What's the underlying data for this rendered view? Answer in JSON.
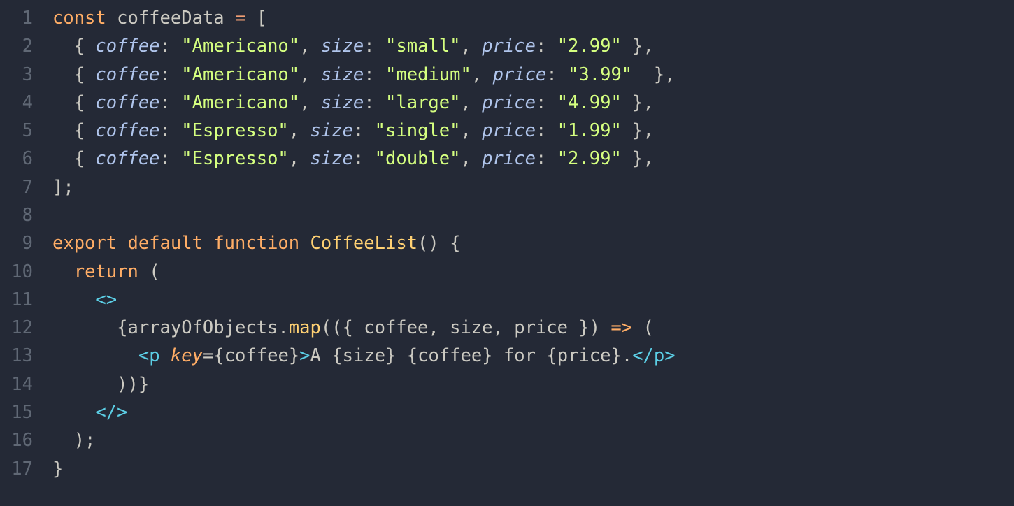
{
  "editor": {
    "lineCount": 17,
    "lines": [
      [
        {
          "t": "const",
          "c": "tok-kw"
        },
        {
          "t": " ",
          "c": ""
        },
        {
          "t": "coffeeData",
          "c": "tok-var"
        },
        {
          "t": " ",
          "c": ""
        },
        {
          "t": "=",
          "c": "tok-op"
        },
        {
          "t": " [",
          "c": "tok-punc"
        }
      ],
      [
        {
          "t": "  { ",
          "c": "tok-punc"
        },
        {
          "t": "coffee",
          "c": "tok-key"
        },
        {
          "t": ": ",
          "c": "tok-punc"
        },
        {
          "t": "\"Americano\"",
          "c": "tok-str"
        },
        {
          "t": ", ",
          "c": "tok-punc"
        },
        {
          "t": "size",
          "c": "tok-key"
        },
        {
          "t": ": ",
          "c": "tok-punc"
        },
        {
          "t": "\"small\"",
          "c": "tok-str"
        },
        {
          "t": ", ",
          "c": "tok-punc"
        },
        {
          "t": "price",
          "c": "tok-key"
        },
        {
          "t": ": ",
          "c": "tok-punc"
        },
        {
          "t": "\"2.99\"",
          "c": "tok-str"
        },
        {
          "t": " },",
          "c": "tok-punc"
        }
      ],
      [
        {
          "t": "  { ",
          "c": "tok-punc"
        },
        {
          "t": "coffee",
          "c": "tok-key"
        },
        {
          "t": ": ",
          "c": "tok-punc"
        },
        {
          "t": "\"Americano\"",
          "c": "tok-str"
        },
        {
          "t": ", ",
          "c": "tok-punc"
        },
        {
          "t": "size",
          "c": "tok-key"
        },
        {
          "t": ": ",
          "c": "tok-punc"
        },
        {
          "t": "\"medium\"",
          "c": "tok-str"
        },
        {
          "t": ", ",
          "c": "tok-punc"
        },
        {
          "t": "price",
          "c": "tok-key"
        },
        {
          "t": ": ",
          "c": "tok-punc"
        },
        {
          "t": "\"3.99\"",
          "c": "tok-str"
        },
        {
          "t": "  },",
          "c": "tok-punc"
        }
      ],
      [
        {
          "t": "  { ",
          "c": "tok-punc"
        },
        {
          "t": "coffee",
          "c": "tok-key"
        },
        {
          "t": ": ",
          "c": "tok-punc"
        },
        {
          "t": "\"Americano\"",
          "c": "tok-str"
        },
        {
          "t": ", ",
          "c": "tok-punc"
        },
        {
          "t": "size",
          "c": "tok-key"
        },
        {
          "t": ": ",
          "c": "tok-punc"
        },
        {
          "t": "\"large\"",
          "c": "tok-str"
        },
        {
          "t": ", ",
          "c": "tok-punc"
        },
        {
          "t": "price",
          "c": "tok-key"
        },
        {
          "t": ": ",
          "c": "tok-punc"
        },
        {
          "t": "\"4.99\"",
          "c": "tok-str"
        },
        {
          "t": " },",
          "c": "tok-punc"
        }
      ],
      [
        {
          "t": "  { ",
          "c": "tok-punc"
        },
        {
          "t": "coffee",
          "c": "tok-key"
        },
        {
          "t": ": ",
          "c": "tok-punc"
        },
        {
          "t": "\"Espresso\"",
          "c": "tok-str"
        },
        {
          "t": ", ",
          "c": "tok-punc"
        },
        {
          "t": "size",
          "c": "tok-key"
        },
        {
          "t": ": ",
          "c": "tok-punc"
        },
        {
          "t": "\"single\"",
          "c": "tok-str"
        },
        {
          "t": ", ",
          "c": "tok-punc"
        },
        {
          "t": "price",
          "c": "tok-key"
        },
        {
          "t": ": ",
          "c": "tok-punc"
        },
        {
          "t": "\"1.99\"",
          "c": "tok-str"
        },
        {
          "t": " },",
          "c": "tok-punc"
        }
      ],
      [
        {
          "t": "  { ",
          "c": "tok-punc"
        },
        {
          "t": "coffee",
          "c": "tok-key"
        },
        {
          "t": ": ",
          "c": "tok-punc"
        },
        {
          "t": "\"Espresso\"",
          "c": "tok-str"
        },
        {
          "t": ", ",
          "c": "tok-punc"
        },
        {
          "t": "size",
          "c": "tok-key"
        },
        {
          "t": ": ",
          "c": "tok-punc"
        },
        {
          "t": "\"double\"",
          "c": "tok-str"
        },
        {
          "t": ", ",
          "c": "tok-punc"
        },
        {
          "t": "price",
          "c": "tok-key"
        },
        {
          "t": ": ",
          "c": "tok-punc"
        },
        {
          "t": "\"2.99\"",
          "c": "tok-str"
        },
        {
          "t": " },",
          "c": "tok-punc"
        }
      ],
      [
        {
          "t": "];",
          "c": "tok-punc"
        }
      ],
      [
        {
          "t": " ",
          "c": ""
        }
      ],
      [
        {
          "t": "export",
          "c": "tok-kw"
        },
        {
          "t": " ",
          "c": ""
        },
        {
          "t": "default",
          "c": "tok-kw"
        },
        {
          "t": " ",
          "c": ""
        },
        {
          "t": "function",
          "c": "tok-kw"
        },
        {
          "t": " ",
          "c": ""
        },
        {
          "t": "CoffeeList",
          "c": "tok-fn"
        },
        {
          "t": "() {",
          "c": "tok-punc"
        }
      ],
      [
        {
          "t": "  ",
          "c": ""
        },
        {
          "t": "return",
          "c": "tok-kw"
        },
        {
          "t": " (",
          "c": "tok-punc"
        }
      ],
      [
        {
          "t": "    ",
          "c": ""
        },
        {
          "t": "<>",
          "c": "tok-tag"
        }
      ],
      [
        {
          "t": "      {",
          "c": "tok-punc"
        },
        {
          "t": "arrayOfObjects",
          "c": "tok-var"
        },
        {
          "t": ".",
          "c": "tok-punc"
        },
        {
          "t": "map",
          "c": "tok-fn"
        },
        {
          "t": "(({ ",
          "c": "tok-punc"
        },
        {
          "t": "coffee",
          "c": "tok-var"
        },
        {
          "t": ", ",
          "c": "tok-punc"
        },
        {
          "t": "size",
          "c": "tok-var"
        },
        {
          "t": ", ",
          "c": "tok-punc"
        },
        {
          "t": "price",
          "c": "tok-var"
        },
        {
          "t": " }) ",
          "c": "tok-punc"
        },
        {
          "t": "=>",
          "c": "tok-kw"
        },
        {
          "t": " (",
          "c": "tok-punc"
        }
      ],
      [
        {
          "t": "        ",
          "c": ""
        },
        {
          "t": "<",
          "c": "tok-tag"
        },
        {
          "t": "p",
          "c": "tok-tag"
        },
        {
          "t": " ",
          "c": ""
        },
        {
          "t": "key",
          "c": "tok-attr"
        },
        {
          "t": "=",
          "c": "tok-punc"
        },
        {
          "t": "{",
          "c": "tok-punc"
        },
        {
          "t": "coffee",
          "c": "tok-var"
        },
        {
          "t": "}",
          "c": "tok-punc"
        },
        {
          "t": ">",
          "c": "tok-tag"
        },
        {
          "t": "A ",
          "c": "tok-var"
        },
        {
          "t": "{",
          "c": "tok-punc"
        },
        {
          "t": "size",
          "c": "tok-var"
        },
        {
          "t": "}",
          "c": "tok-punc"
        },
        {
          "t": " ",
          "c": "tok-var"
        },
        {
          "t": "{",
          "c": "tok-punc"
        },
        {
          "t": "coffee",
          "c": "tok-var"
        },
        {
          "t": "}",
          "c": "tok-punc"
        },
        {
          "t": " for ",
          "c": "tok-var"
        },
        {
          "t": "{",
          "c": "tok-punc"
        },
        {
          "t": "price",
          "c": "tok-var"
        },
        {
          "t": "}",
          "c": "tok-punc"
        },
        {
          "t": ".",
          "c": "tok-var"
        },
        {
          "t": "</",
          "c": "tok-tag"
        },
        {
          "t": "p",
          "c": "tok-tag"
        },
        {
          "t": ">",
          "c": "tok-tag"
        }
      ],
      [
        {
          "t": "      ))}",
          "c": "tok-punc"
        }
      ],
      [
        {
          "t": "    ",
          "c": ""
        },
        {
          "t": "</>",
          "c": "tok-tag"
        }
      ],
      [
        {
          "t": "  );",
          "c": "tok-punc"
        }
      ],
      [
        {
          "t": "}",
          "c": "tok-punc"
        }
      ]
    ]
  }
}
